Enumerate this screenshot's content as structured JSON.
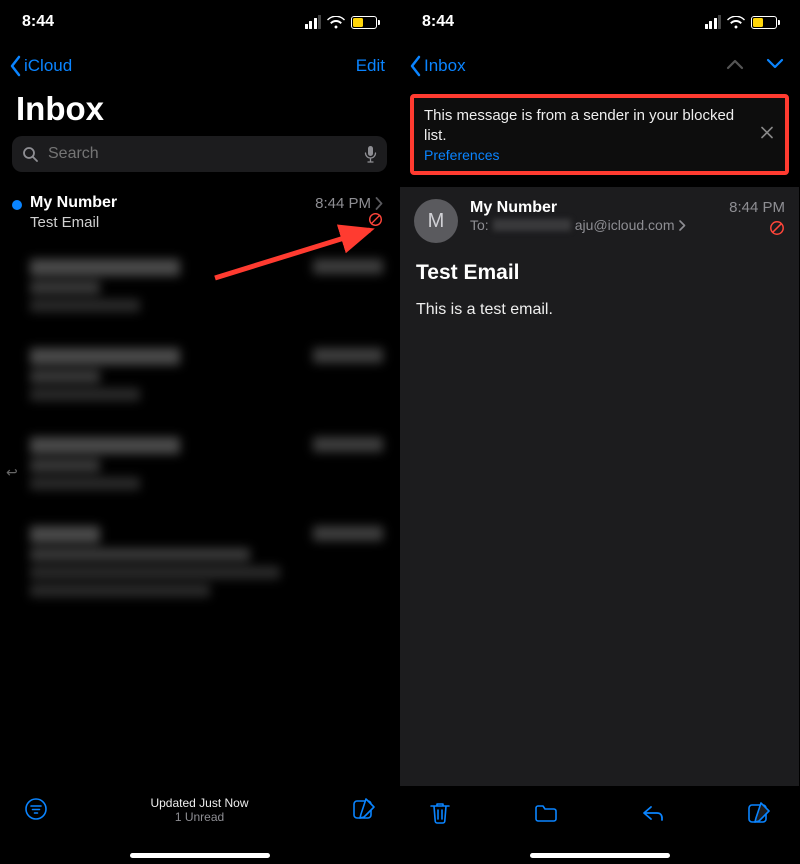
{
  "status": {
    "time": "8:44"
  },
  "left": {
    "back_label": "iCloud",
    "edit_label": "Edit",
    "title": "Inbox",
    "search_placeholder": "Search",
    "email": {
      "sender": "My Number",
      "time": "8:44 PM",
      "subject": "Test Email"
    },
    "footer": {
      "status": "Updated Just Now",
      "unread": "1 Unread"
    }
  },
  "right": {
    "back_label": "Inbox",
    "banner": {
      "text": "This message is from a sender in your blocked list.",
      "link": "Preferences"
    },
    "avatar_initial": "M",
    "from": "My Number",
    "to_prefix": "To:",
    "to_suffix": "aju@icloud.com",
    "time": "8:44 PM",
    "subject": "Test Email",
    "body": "This is a test email."
  }
}
